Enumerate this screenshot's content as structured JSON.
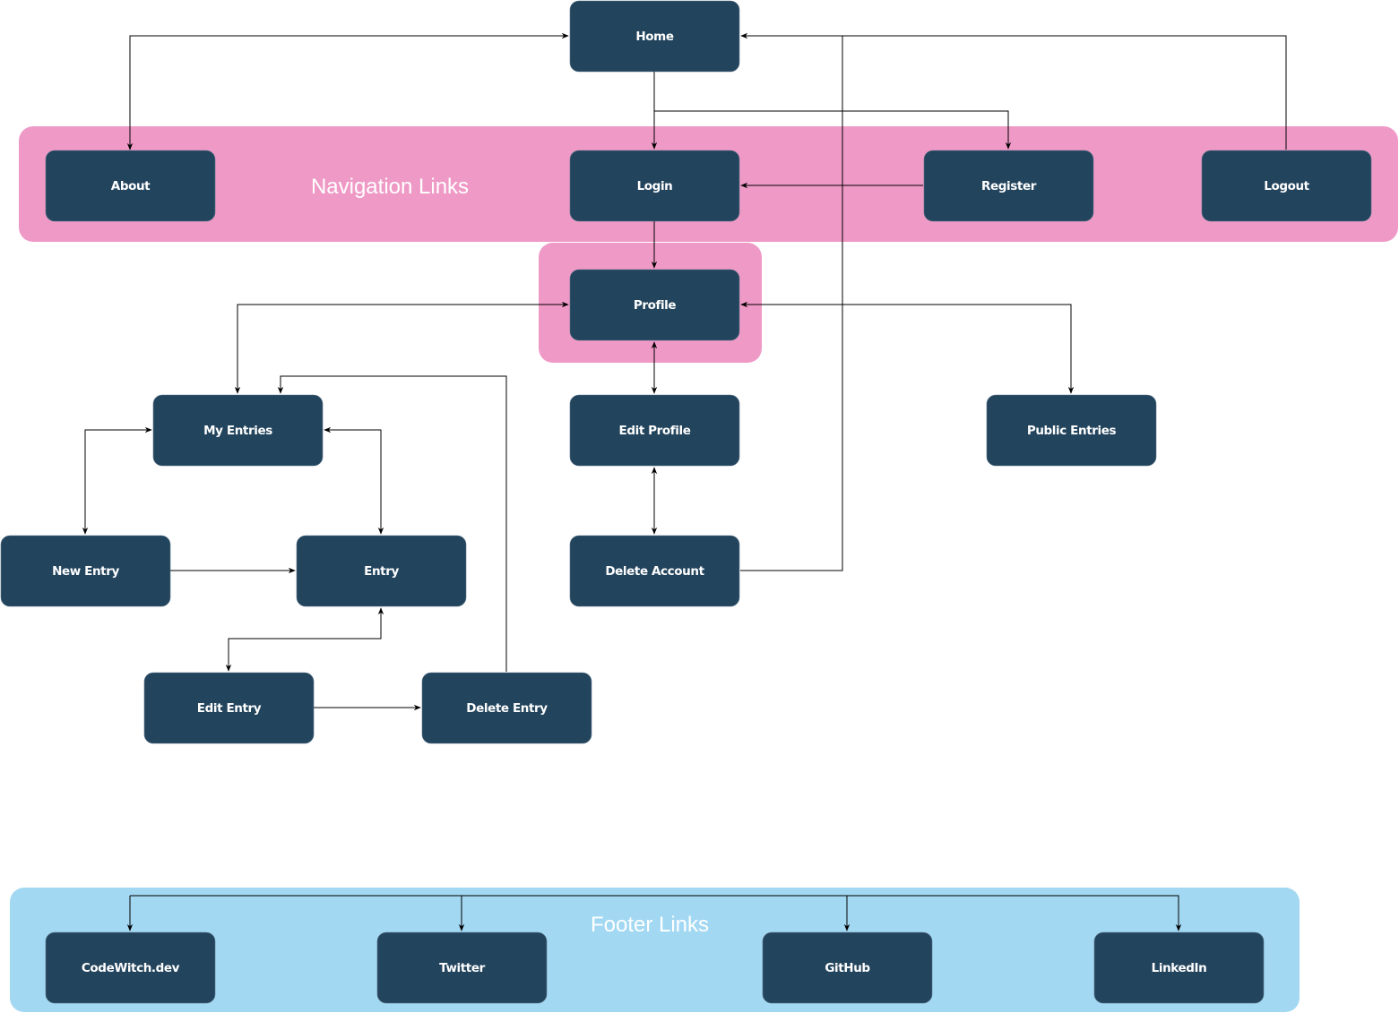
{
  "colors": {
    "node_fill": "#23445d",
    "node_text": "#ffffff",
    "nav_group": "#ef9ac6",
    "footer_group": "#a3d8f3",
    "edge": "#000000"
  },
  "groups": {
    "navigation": {
      "label": "Navigation Links"
    },
    "footer": {
      "label": "Footer Links"
    }
  },
  "nodes": [
    {
      "id": "home",
      "label": "Home"
    },
    {
      "id": "about",
      "label": "About"
    },
    {
      "id": "login",
      "label": "Login"
    },
    {
      "id": "register",
      "label": "Register"
    },
    {
      "id": "logout",
      "label": "Logout"
    },
    {
      "id": "profile",
      "label": "Profile"
    },
    {
      "id": "my-entries",
      "label": "My Entries"
    },
    {
      "id": "edit-profile",
      "label": "Edit Profile"
    },
    {
      "id": "public-entries",
      "label": "Public Entries"
    },
    {
      "id": "new-entry",
      "label": "New Entry"
    },
    {
      "id": "entry",
      "label": "Entry"
    },
    {
      "id": "delete-account",
      "label": "Delete Account"
    },
    {
      "id": "edit-entry",
      "label": "Edit Entry"
    },
    {
      "id": "delete-entry",
      "label": "Delete Entry"
    },
    {
      "id": "codewitch",
      "label": "CodeWitch.dev"
    },
    {
      "id": "twitter",
      "label": "Twitter"
    },
    {
      "id": "github",
      "label": "GitHub"
    },
    {
      "id": "linkedin",
      "label": "LinkedIn"
    }
  ],
  "edges": [
    {
      "from": "about",
      "to": "home",
      "bidirectional": true
    },
    {
      "from": "home",
      "to": "login",
      "bidirectional": false
    },
    {
      "from": "home",
      "to": "register",
      "bidirectional": false
    },
    {
      "from": "logout",
      "to": "home",
      "bidirectional": false
    },
    {
      "from": "delete-account",
      "to": "home",
      "bidirectional": false
    },
    {
      "from": "register",
      "to": "login",
      "bidirectional": false
    },
    {
      "from": "login",
      "to": "profile",
      "bidirectional": false
    },
    {
      "from": "profile",
      "to": "my-entries",
      "bidirectional": true
    },
    {
      "from": "profile",
      "to": "public-entries",
      "bidirectional": true
    },
    {
      "from": "profile",
      "to": "edit-profile",
      "bidirectional": true
    },
    {
      "from": "edit-profile",
      "to": "delete-account",
      "bidirectional": true
    },
    {
      "from": "my-entries",
      "to": "new-entry",
      "bidirectional": true
    },
    {
      "from": "my-entries",
      "to": "entry",
      "bidirectional": true
    },
    {
      "from": "new-entry",
      "to": "entry",
      "bidirectional": false
    },
    {
      "from": "entry",
      "to": "edit-entry",
      "bidirectional": true
    },
    {
      "from": "edit-entry",
      "to": "delete-entry",
      "bidirectional": false
    },
    {
      "from": "delete-entry",
      "to": "my-entries",
      "bidirectional": false
    },
    {
      "from": "footer",
      "to": "codewitch",
      "bidirectional": false
    },
    {
      "from": "footer",
      "to": "twitter",
      "bidirectional": false
    },
    {
      "from": "footer",
      "to": "github",
      "bidirectional": false
    },
    {
      "from": "footer",
      "to": "linkedin",
      "bidirectional": false
    }
  ]
}
